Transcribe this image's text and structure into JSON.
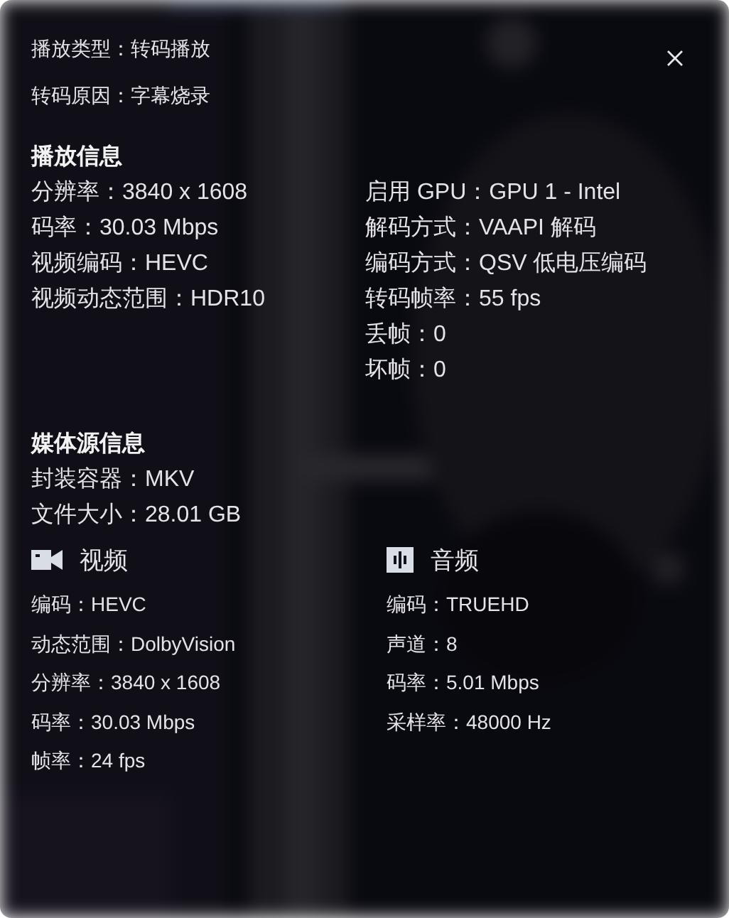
{
  "header": [
    "播放类型：转码播放",
    "转码原因：字幕烧录"
  ],
  "playback": {
    "title": "播放信息",
    "left": [
      "分辨率：3840 x 1608",
      "码率：30.03 Mbps",
      "视频编码：HEVC",
      "视频动态范围：HDR10"
    ],
    "right": [
      "启用 GPU：GPU 1 - Intel",
      "解码方式：VAAPI 解码",
      "编码方式：QSV 低电压编码",
      "转码帧率：55 fps",
      "丢帧：0",
      "坏帧：0"
    ]
  },
  "media": {
    "title": "媒体源信息",
    "lines": [
      "封装容器：MKV",
      "文件大小：28.01 GB"
    ],
    "streams": [
      {
        "kind": "video",
        "title": "视频",
        "lines": [
          "编码：HEVC",
          "动态范围：DolbyVision",
          "分辨率：3840 x 1608",
          "码率：30.03 Mbps",
          "帧率：24 fps"
        ]
      },
      {
        "kind": "audio",
        "title": "音频",
        "lines": [
          "编码：TRUEHD",
          "声道：8",
          "码率：5.01 Mbps",
          "采样率：48000 Hz"
        ]
      }
    ]
  }
}
